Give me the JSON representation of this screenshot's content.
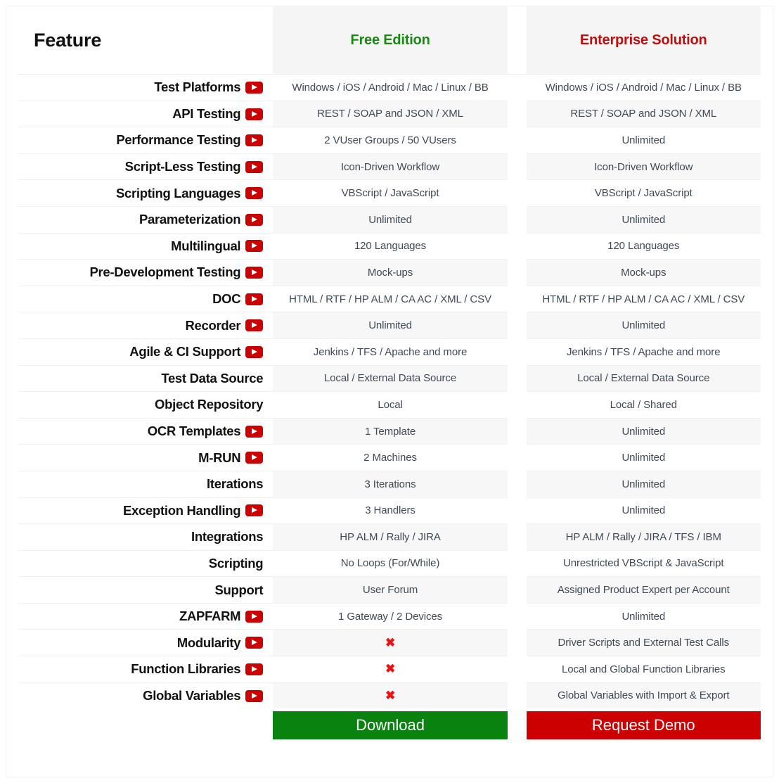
{
  "table": {
    "columns": {
      "feature_header": "Feature",
      "free_header": "Free Edition",
      "enterprise_header": "Enterprise Solution"
    },
    "colors": {
      "free_accent": "#1a8a14",
      "enterprise_accent": "#c00d0d",
      "play_icon": "#cc0000",
      "cross_mark": "#ee1111",
      "download_button": "#0a8210",
      "demo_button": "#cc0000"
    },
    "rows": [
      {
        "feature": "Test Platforms",
        "icon": "play-icon",
        "free": "Windows / iOS / Android / Mac / Linux / BB",
        "enterprise": "Windows / iOS / Android / Mac / Linux / BB"
      },
      {
        "feature": "API Testing",
        "icon": "play-icon",
        "free": "REST / SOAP and JSON / XML",
        "enterprise": "REST / SOAP and JSON / XML"
      },
      {
        "feature": "Performance Testing",
        "icon": "play-icon",
        "free": "2 VUser Groups / 50 VUsers",
        "enterprise": "Unlimited"
      },
      {
        "feature": "Script-Less Testing",
        "icon": "play-icon",
        "free": "Icon-Driven Workflow",
        "enterprise": "Icon-Driven Workflow"
      },
      {
        "feature": "Scripting Languages",
        "icon": "play-icon",
        "free": "VBScript / JavaScript",
        "enterprise": "VBScript / JavaScript"
      },
      {
        "feature": "Parameterization",
        "icon": "play-icon",
        "free": "Unlimited",
        "enterprise": "Unlimited"
      },
      {
        "feature": "Multilingual",
        "icon": "play-icon",
        "free": "120 Languages",
        "enterprise": "120 Languages"
      },
      {
        "feature": "Pre-Development Testing",
        "icon": "play-icon",
        "free": "Mock-ups",
        "enterprise": "Mock-ups"
      },
      {
        "feature": "DOC",
        "icon": "play-icon",
        "free": "HTML / RTF / HP ALM / CA AC / XML / CSV",
        "enterprise": "HTML / RTF / HP ALM / CA AC / XML / CSV"
      },
      {
        "feature": "Recorder",
        "icon": "play-icon",
        "free": "Unlimited",
        "enterprise": "Unlimited"
      },
      {
        "feature": "Agile & CI Support",
        "icon": "play-icon",
        "free": "Jenkins / TFS / Apache and more",
        "enterprise": "Jenkins / TFS / Apache and more"
      },
      {
        "feature": "Test Data Source",
        "icon": null,
        "free": "Local / External Data Source",
        "enterprise": "Local / External Data Source"
      },
      {
        "feature": "Object Repository",
        "icon": null,
        "free": "Local",
        "enterprise": "Local / Shared"
      },
      {
        "feature": "OCR Templates",
        "icon": "play-icon",
        "free": "1 Template",
        "enterprise": "Unlimited"
      },
      {
        "feature": "M-RUN",
        "icon": "play-icon",
        "free": "2 Machines",
        "enterprise": "Unlimited"
      },
      {
        "feature": "Iterations",
        "icon": null,
        "free": "3 Iterations",
        "enterprise": "Unlimited"
      },
      {
        "feature": "Exception Handling",
        "icon": "play-icon",
        "free": "3 Handlers",
        "enterprise": "Unlimited"
      },
      {
        "feature": "Integrations",
        "icon": null,
        "free": "HP ALM / Rally / JIRA",
        "enterprise": "HP ALM / Rally / JIRA / TFS / IBM"
      },
      {
        "feature": "Scripting",
        "icon": null,
        "free": "No Loops (For/While)",
        "enterprise": "Unrestricted VBScript & JavaScript"
      },
      {
        "feature": "Support",
        "icon": null,
        "free": "User Forum",
        "enterprise": "Assigned Product Expert per Account"
      },
      {
        "feature": "ZAPFARM",
        "icon": "play-icon",
        "free": "1 Gateway / 2 Devices",
        "enterprise": "Unlimited"
      },
      {
        "feature": "Modularity",
        "icon": "play-icon",
        "free": "✖",
        "enterprise": "Driver Scripts and External Test Calls"
      },
      {
        "feature": "Function Libraries",
        "icon": "play-icon",
        "free": "✖",
        "enterprise": "Local and Global Function Libraries"
      },
      {
        "feature": "Global Variables",
        "icon": "play-icon",
        "free": "✖",
        "enterprise": "Global Variables with Import & Export"
      }
    ],
    "footer": {
      "download_label": "Download",
      "demo_label": "Request Demo"
    }
  }
}
